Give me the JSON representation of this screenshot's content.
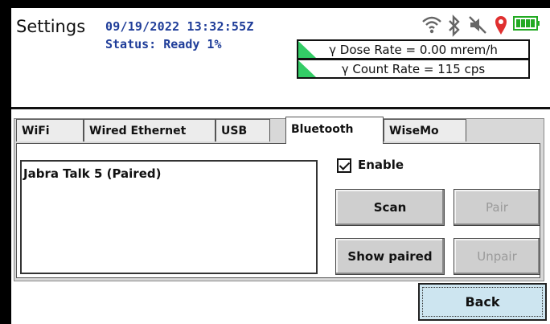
{
  "header": {
    "title": "Settings",
    "datetime": "09/19/2022 13:32:55Z",
    "status": "Status: Ready 1%",
    "dose_rate": "γ Dose Rate = 0.00 mrem/h",
    "count_rate": "γ Count Rate = 115 cps",
    "icons": [
      "wifi-icon",
      "bluetooth-icon",
      "speaker-muted-icon",
      "location-icon",
      "battery-icon"
    ],
    "colors": {
      "accent": "#1f3d99",
      "indicator": "#33cc66",
      "location": "#e03030",
      "battery": "#22aa22"
    }
  },
  "tabs": [
    {
      "label": "WiFi"
    },
    {
      "label": "Wired Ethernet"
    },
    {
      "label": "USB"
    },
    {
      "label": "Bluetooth"
    },
    {
      "label": "WiseMo"
    }
  ],
  "active_tab": "Bluetooth",
  "bluetooth": {
    "devices": [
      "Jabra Talk 5 (Paired)"
    ],
    "enable_label": "Enable",
    "enable_checked": true,
    "scan_label": "Scan",
    "pair_label": "Pair",
    "show_paired_label": "Show paired",
    "unpair_label": "Unpair"
  },
  "footer": {
    "back_label": "Back"
  }
}
